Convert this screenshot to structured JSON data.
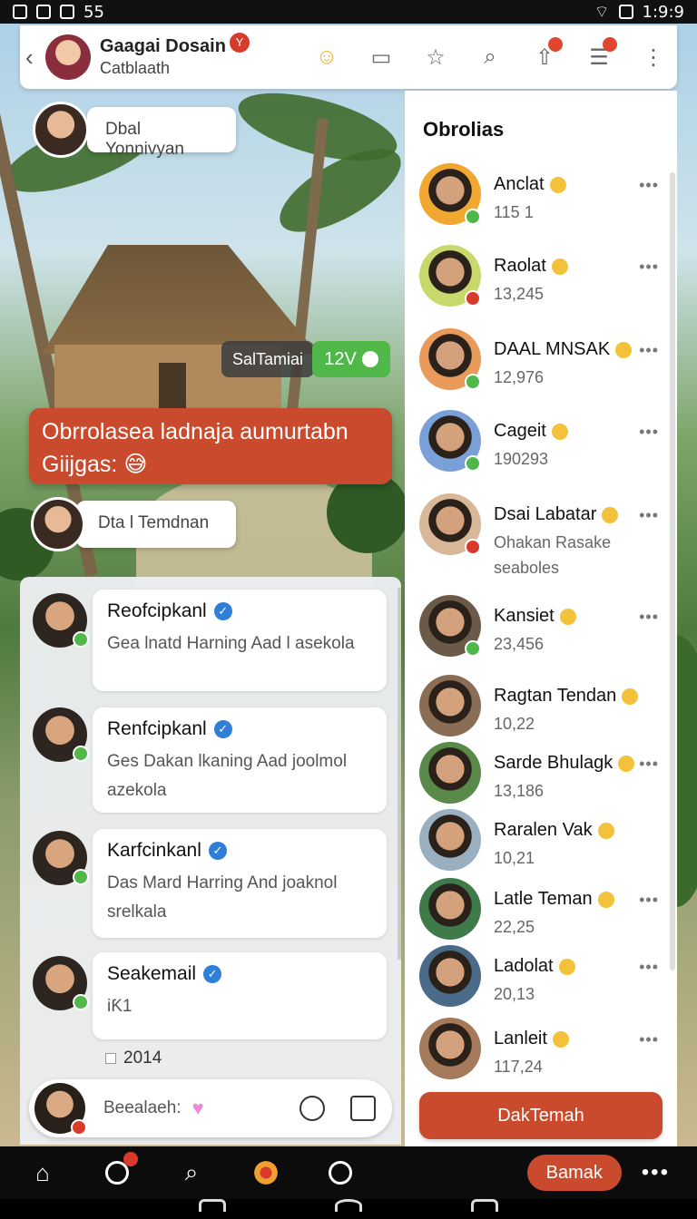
{
  "status_bar": {
    "left_text": "55",
    "time": "1:9:9"
  },
  "header": {
    "title": "Gaagai Dosain",
    "subtitle": "Catblaath",
    "badge": "Y",
    "back_icon": "chevron-left-icon"
  },
  "bubbles": {
    "top_label": "Dbal Yonnivyan",
    "dark_tag": "SalTamiai",
    "green_tag": "12V",
    "banner": "Obrrolasea ladnaja aumurtabn Giijgas:",
    "mid_label": "Dta l Temdnan"
  },
  "messages": [
    {
      "name": "Reofcipkanl",
      "text": "Gea lnatd Harning Aad l asekola"
    },
    {
      "name": "Renfcipkanl",
      "text": "Ges Dakan lkaning Aad joolmol azekola"
    },
    {
      "name": "Karfcinkanl",
      "text": "Das Mard Harring And joaknol srelkala"
    },
    {
      "name": "Seakemail",
      "text": "iƘ1"
    }
  ],
  "date_label": "2014",
  "composer": {
    "placeholder": "Beealaeh:"
  },
  "list": {
    "title": "Obrolias",
    "friends": [
      {
        "name": "Anclat",
        "count": "115 1",
        "status_color": "#4fb848",
        "avatar_color": "#f0a830"
      },
      {
        "name": "Raolat",
        "count": "13,245",
        "status_color": "#d83a2b",
        "avatar_color": "#c9d86a"
      },
      {
        "name": "DAAL MNSAK",
        "count": "12,976",
        "status_color": "#4fb848",
        "avatar_color": "#e89a5a"
      },
      {
        "name": "Cageit",
        "count": "190293",
        "status_color": "#4fb848",
        "avatar_color": "#7aa0d8"
      },
      {
        "name": "Dsai Labatar",
        "count": "Ohakan Rasake seaboles",
        "status_color": "#d83a2b",
        "avatar_color": "#d9b89a"
      },
      {
        "name": "Kansiet",
        "count": "23,456",
        "status_color": "#4fb848",
        "avatar_color": "#6b5a4a"
      },
      {
        "name": "Ragtan Tendan",
        "count": "10,22",
        "status_color": "",
        "avatar_color": "#8a6d55"
      },
      {
        "name": "Sarde Bhulagk",
        "count": "13,186",
        "status_color": "",
        "avatar_color": "#5a8a4a"
      },
      {
        "name": "Raralen Vak",
        "count": "10,21",
        "status_color": "",
        "avatar_color": "#9ab0c0"
      },
      {
        "name": "Latle Teman",
        "count": "22,25",
        "status_color": "",
        "avatar_color": "#3e7a4a"
      },
      {
        "name": "Ladolat",
        "count": "20,13",
        "status_color": "",
        "avatar_color": "#4a6a8a"
      },
      {
        "name": "Lanleit",
        "count": "117,24",
        "status_color": "",
        "avatar_color": "#a57a5a"
      }
    ],
    "cta": "DakTemah"
  },
  "bottom_nav": {
    "pill": "Bamak"
  },
  "colors": {
    "accent": "#c94a2c",
    "online": "#4fb848",
    "verify": "#2f7fd8"
  }
}
